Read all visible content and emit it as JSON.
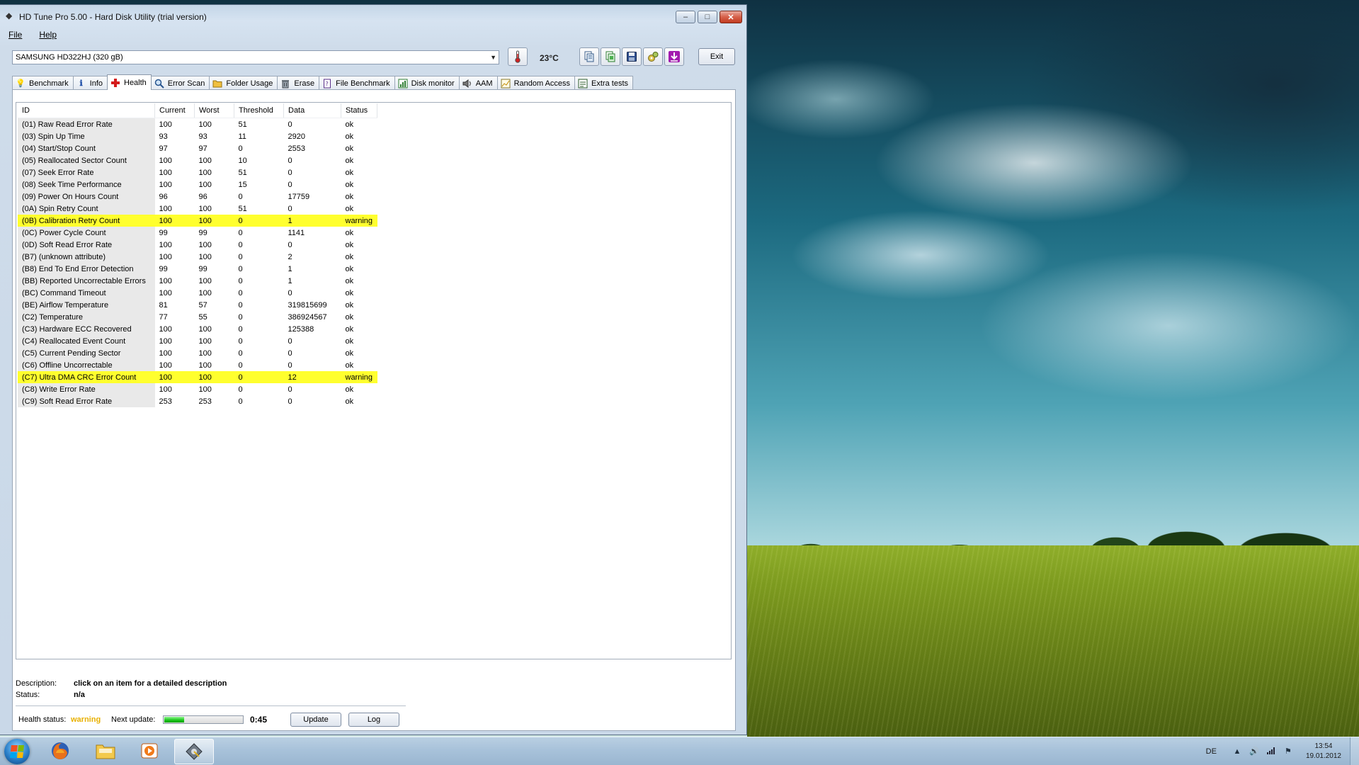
{
  "window": {
    "title": "HD Tune Pro 5.00 - Hard Disk Utility (trial version)",
    "controls": {
      "minimize": "–",
      "maximize": "□",
      "close": "✕"
    }
  },
  "menu": {
    "file": "File",
    "help": "Help"
  },
  "toolbar": {
    "drive": "SAMSUNG HD322HJ (320 gB)",
    "temperature": "23°C",
    "exit_label": "Exit",
    "icons": [
      "thermometer-icon",
      "copy-info-icon",
      "copy-screenshot-icon",
      "save-icon",
      "options-icon",
      "download-icon"
    ]
  },
  "tabs": [
    {
      "label": "Benchmark",
      "icon": "benchmark-icon"
    },
    {
      "label": "Info",
      "icon": "info-icon"
    },
    {
      "label": "Health",
      "icon": "health-icon",
      "active": true
    },
    {
      "label": "Error Scan",
      "icon": "error-scan-icon"
    },
    {
      "label": "Folder Usage",
      "icon": "folder-icon"
    },
    {
      "label": "Erase",
      "icon": "trash-icon"
    },
    {
      "label": "File Benchmark",
      "icon": "file-benchmark-icon"
    },
    {
      "label": "Disk monitor",
      "icon": "disk-monitor-icon"
    },
    {
      "label": "AAM",
      "icon": "speaker-icon"
    },
    {
      "label": "Random Access",
      "icon": "random-access-icon"
    },
    {
      "label": "Extra tests",
      "icon": "extra-tests-icon"
    }
  ],
  "table": {
    "headers": [
      "ID",
      "Current",
      "Worst",
      "Threshold",
      "Data",
      "Status"
    ],
    "rows": [
      {
        "id": "(01) Raw Read Error Rate",
        "current": "100",
        "worst": "100",
        "threshold": "51",
        "data": "0",
        "status": "ok"
      },
      {
        "id": "(03) Spin Up Time",
        "current": "93",
        "worst": "93",
        "threshold": "11",
        "data": "2920",
        "status": "ok"
      },
      {
        "id": "(04) Start/Stop Count",
        "current": "97",
        "worst": "97",
        "threshold": "0",
        "data": "2553",
        "status": "ok"
      },
      {
        "id": "(05) Reallocated Sector Count",
        "current": "100",
        "worst": "100",
        "threshold": "10",
        "data": "0",
        "status": "ok"
      },
      {
        "id": "(07) Seek Error Rate",
        "current": "100",
        "worst": "100",
        "threshold": "51",
        "data": "0",
        "status": "ok"
      },
      {
        "id": "(08) Seek Time Performance",
        "current": "100",
        "worst": "100",
        "threshold": "15",
        "data": "0",
        "status": "ok"
      },
      {
        "id": "(09) Power On Hours Count",
        "current": "96",
        "worst": "96",
        "threshold": "0",
        "data": "17759",
        "status": "ok"
      },
      {
        "id": "(0A) Spin Retry Count",
        "current": "100",
        "worst": "100",
        "threshold": "51",
        "data": "0",
        "status": "ok"
      },
      {
        "id": "(0B) Calibration Retry Count",
        "current": "100",
        "worst": "100",
        "threshold": "0",
        "data": "1",
        "status": "warning"
      },
      {
        "id": "(0C) Power Cycle Count",
        "current": "99",
        "worst": "99",
        "threshold": "0",
        "data": "1141",
        "status": "ok"
      },
      {
        "id": "(0D) Soft Read Error Rate",
        "current": "100",
        "worst": "100",
        "threshold": "0",
        "data": "0",
        "status": "ok"
      },
      {
        "id": "(B7) (unknown attribute)",
        "current": "100",
        "worst": "100",
        "threshold": "0",
        "data": "2",
        "status": "ok"
      },
      {
        "id": "(B8) End To End Error Detection",
        "current": "99",
        "worst": "99",
        "threshold": "0",
        "data": "1",
        "status": "ok"
      },
      {
        "id": "(BB) Reported Uncorrectable Errors",
        "current": "100",
        "worst": "100",
        "threshold": "0",
        "data": "1",
        "status": "ok"
      },
      {
        "id": "(BC) Command Timeout",
        "current": "100",
        "worst": "100",
        "threshold": "0",
        "data": "0",
        "status": "ok"
      },
      {
        "id": "(BE) Airflow Temperature",
        "current": "81",
        "worst": "57",
        "threshold": "0",
        "data": "319815699",
        "status": "ok"
      },
      {
        "id": "(C2) Temperature",
        "current": "77",
        "worst": "55",
        "threshold": "0",
        "data": "386924567",
        "status": "ok"
      },
      {
        "id": "(C3) Hardware ECC Recovered",
        "current": "100",
        "worst": "100",
        "threshold": "0",
        "data": "125388",
        "status": "ok"
      },
      {
        "id": "(C4) Reallocated Event Count",
        "current": "100",
        "worst": "100",
        "threshold": "0",
        "data": "0",
        "status": "ok"
      },
      {
        "id": "(C5) Current Pending Sector",
        "current": "100",
        "worst": "100",
        "threshold": "0",
        "data": "0",
        "status": "ok"
      },
      {
        "id": "(C6) Offline Uncorrectable",
        "current": "100",
        "worst": "100",
        "threshold": "0",
        "data": "0",
        "status": "ok"
      },
      {
        "id": "(C7) Ultra DMA CRC Error Count",
        "current": "100",
        "worst": "100",
        "threshold": "0",
        "data": "12",
        "status": "warning"
      },
      {
        "id": "(C8) Write Error Rate",
        "current": "100",
        "worst": "100",
        "threshold": "0",
        "data": "0",
        "status": "ok"
      },
      {
        "id": "(C9) Soft Read Error Rate",
        "current": "253",
        "worst": "253",
        "threshold": "0",
        "data": "0",
        "status": "ok"
      }
    ],
    "warning_color": "#ffff2e"
  },
  "details": {
    "description_label": "Description:",
    "description_value": "click on an item for a detailed description",
    "status_label": "Status:",
    "status_value": "n/a"
  },
  "footer": {
    "health_status_label": "Health status:",
    "health_status_value": "warning",
    "health_status_color": "#e8b000",
    "next_update_label": "Next update:",
    "next_update_progress": 0.25,
    "next_update_time": "0:45",
    "update_label": "Update",
    "log_label": "Log"
  },
  "taskbar": {
    "apps": [
      {
        "name": "firefox-icon",
        "active": false
      },
      {
        "name": "explorer-icon",
        "active": false
      },
      {
        "name": "media-player-icon",
        "active": false
      },
      {
        "name": "hdtune-icon",
        "active": true
      }
    ],
    "language": "DE",
    "time": "13:54",
    "date": "19.01.2012"
  }
}
